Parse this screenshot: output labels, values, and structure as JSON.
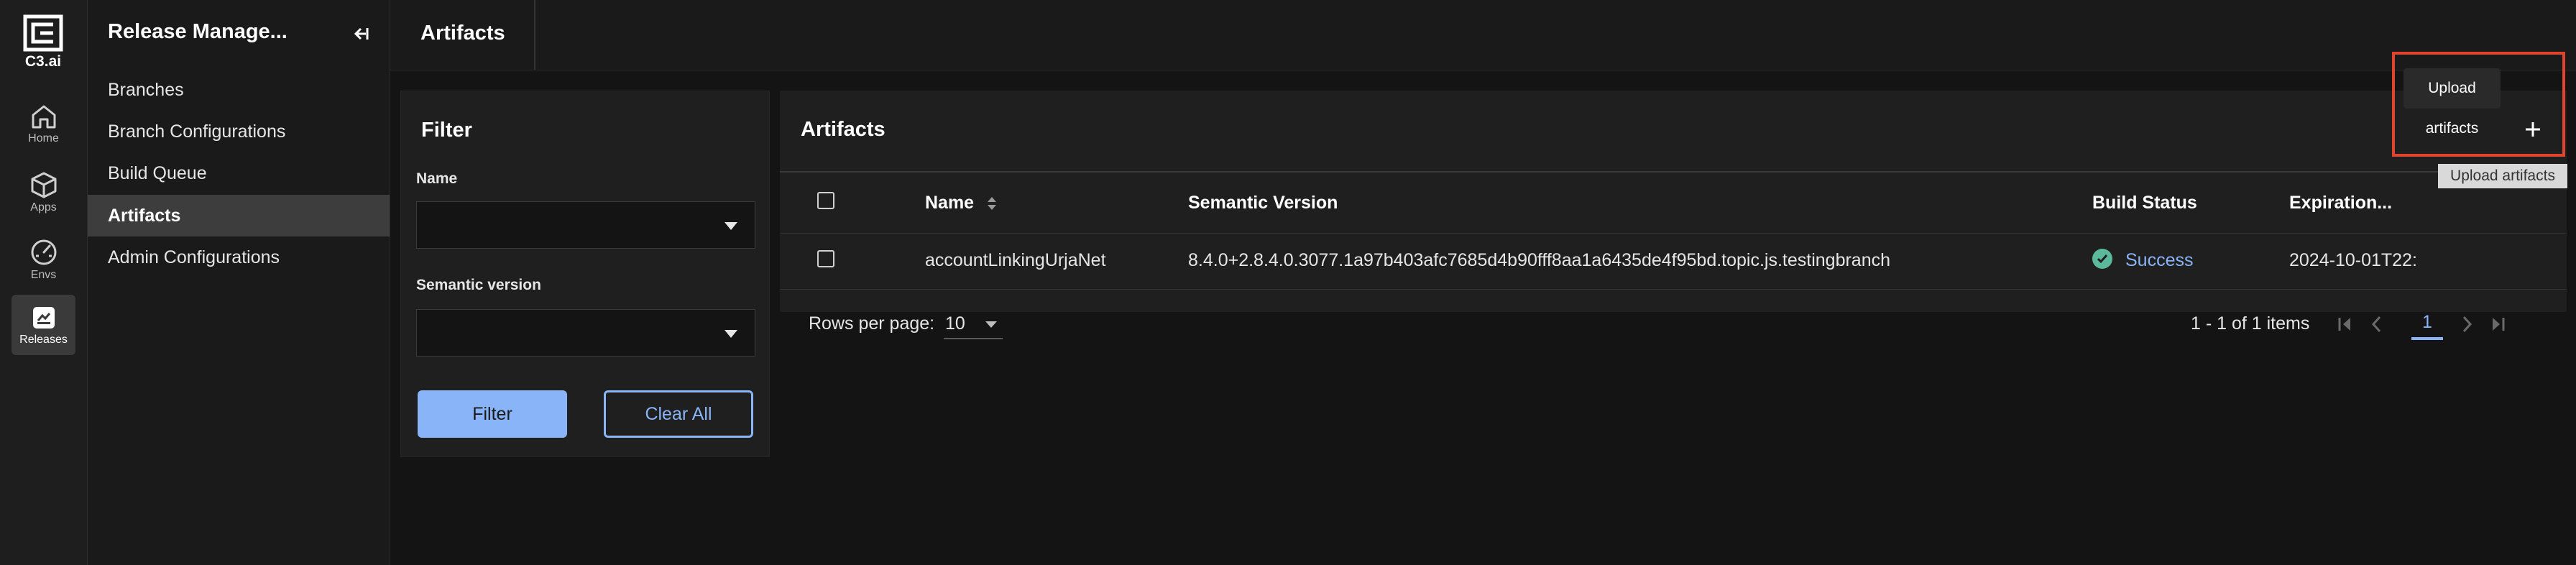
{
  "rail": {
    "logo_text": "C3.ai",
    "items": [
      {
        "label": "Home",
        "icon": "home-icon"
      },
      {
        "label": "Apps",
        "icon": "cube-icon"
      },
      {
        "label": "Envs",
        "icon": "gauge-icon"
      },
      {
        "label": "Releases",
        "icon": "releases-icon",
        "active": true
      }
    ]
  },
  "sidenav": {
    "title": "Release Manage...",
    "items": [
      {
        "label": "Branches"
      },
      {
        "label": "Branch Configurations"
      },
      {
        "label": "Build Queue"
      },
      {
        "label": "Artifacts",
        "active": true
      },
      {
        "label": "Admin Configurations"
      }
    ]
  },
  "header": {
    "title": "Artifacts"
  },
  "filter": {
    "title": "Filter",
    "name_label": "Name",
    "name_value": "",
    "semver_label": "Semantic version",
    "semver_value": "",
    "filter_button": "Filter",
    "clear_button": "Clear All"
  },
  "artifacts": {
    "title": "Artifacts",
    "columns": [
      "Name",
      "Semantic Version",
      "Build Status",
      "Expiration..."
    ],
    "rows": [
      {
        "name": "accountLinkingUrjaNet",
        "semantic_version": "8.4.0+2.8.4.0.3077.1a97b403afc7685d4b90fff8aa1a6435de4f95bd.topic.js.testingbranch",
        "build_status": "Success",
        "expiration": "2024-10-01T22:"
      }
    ],
    "footer": {
      "rows_per_page_label": "Rows per page:",
      "rows_per_page": "10",
      "range": "1 - 1 of 1 items",
      "current_page": "1"
    }
  },
  "upload": {
    "tooltip_dark": "Upload artifacts",
    "tooltip_light": "Upload artifacts",
    "button_icon": "plus-icon"
  },
  "colors": {
    "accent": "#8ab4f8",
    "success": "#5bb89a",
    "highlight": "#e0442e"
  }
}
